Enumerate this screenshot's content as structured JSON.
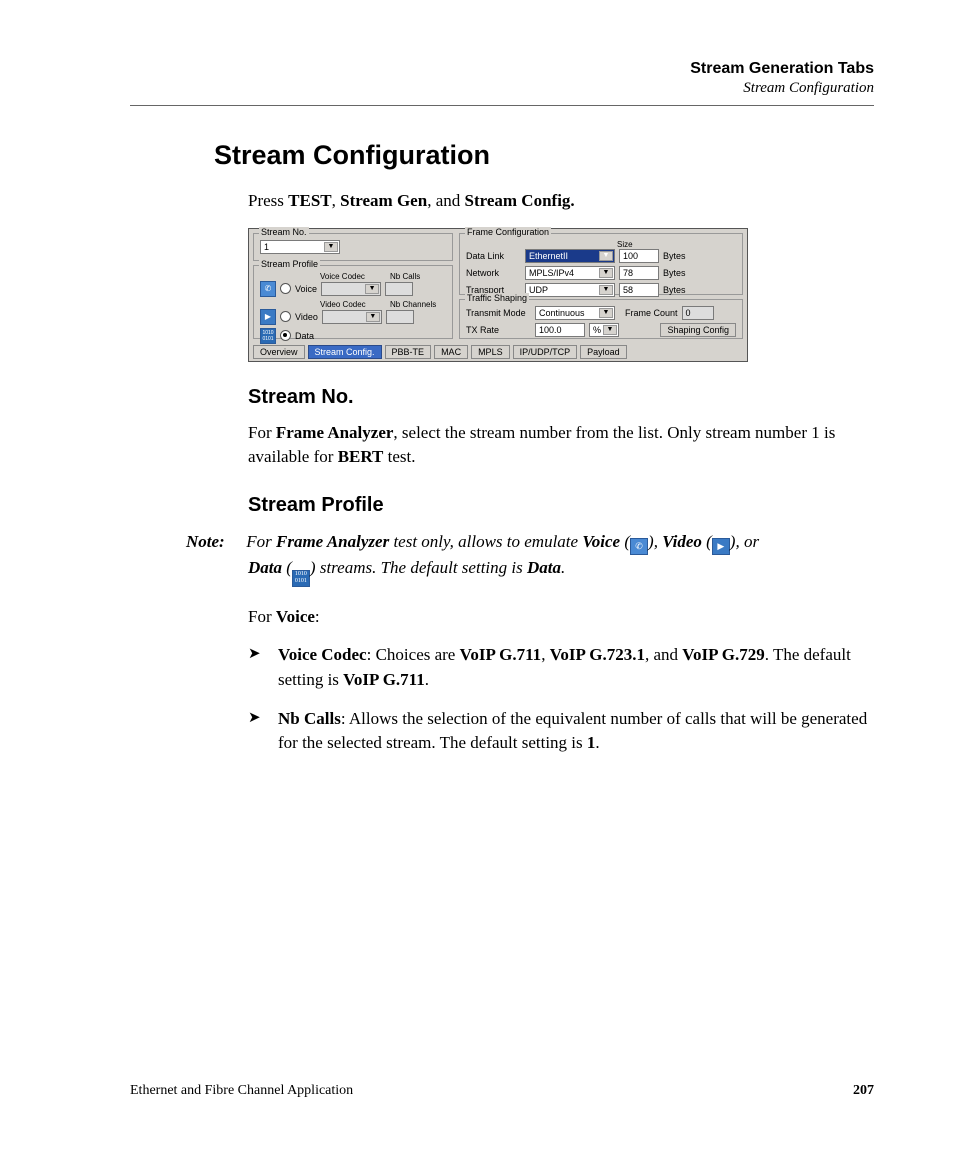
{
  "header": {
    "chapter": "Stream Generation Tabs",
    "section": "Stream Configuration"
  },
  "h1": "Stream Configuration",
  "intro": {
    "prefix": "Press ",
    "b1": "TEST",
    "sep1": ", ",
    "b2": "Stream Gen",
    "sep2": ", and ",
    "b3": "Stream Config.",
    "suffix": ""
  },
  "ui": {
    "stream_no": {
      "label": "Stream No.",
      "value": "1"
    },
    "stream_profile": {
      "label": "Stream Profile",
      "voice_codec_lbl": "Voice Codec",
      "nb_calls_lbl": "Nb Calls",
      "video_codec_lbl": "Video Codec",
      "nb_channels_lbl": "Nb Channels",
      "voice": "Voice",
      "video": "Video",
      "data": "Data"
    },
    "frame_cfg": {
      "label": "Frame Configuration",
      "size_lbl": "Size",
      "datalink_lbl": "Data Link",
      "datalink_val": "EthernetII",
      "datalink_size": "100",
      "network_lbl": "Network",
      "network_val": "MPLS/IPv4",
      "network_size": "78",
      "transport_lbl": "Transport",
      "transport_val": "UDP",
      "transport_size": "58",
      "bytes": "Bytes"
    },
    "shaping": {
      "label": "Traffic Shaping",
      "tx_mode_lbl": "Transmit Mode",
      "tx_mode_val": "Continuous",
      "frame_count_lbl": "Frame Count",
      "frame_count_val": "0",
      "tx_rate_lbl": "TX Rate",
      "tx_rate_val": "100.0",
      "pct": "%",
      "btn": "Shaping Config"
    },
    "tabs": [
      "Overview",
      "Stream Config.",
      "PBB-TE",
      "MAC",
      "MPLS",
      "IP/UDP/TCP",
      "Payload"
    ]
  },
  "h2a": "Stream No.",
  "p_streamno": {
    "t1": "For ",
    "b1": "Frame Analyzer",
    "t2": ", select the stream number from the list. Only stream number 1 is available for ",
    "b2": "BERT",
    "t3": " test."
  },
  "h2b": "Stream Profile",
  "note": {
    "label": "Note:",
    "t1": "For ",
    "b1": "Frame Analyzer",
    "t2": " test only, allows to emulate ",
    "b2": "Voice",
    "t3": " (",
    "t4": "), ",
    "b3": "Video",
    "t5": " (",
    "t6": "), or ",
    "b4": "Data",
    "t7": " (",
    "t8": ") streams. The default setting is ",
    "b5": "Data",
    "t9": "."
  },
  "for_voice": {
    "t1": "For ",
    "b1": "Voice",
    "t2": ":"
  },
  "li1": {
    "b1": "Voice Codec",
    "t1": ": Choices are ",
    "b2": "VoIP G.711",
    "t2": ", ",
    "b3": "VoIP G.723.1",
    "t3": ", and ",
    "b4": "VoIP G.729",
    "t4": ". The default setting is ",
    "b5": "VoIP G.711",
    "t5": "."
  },
  "li2": {
    "b1": "Nb Calls",
    "t1": ": Allows the selection of the equivalent number of calls that will be generated for the selected stream. The default setting is ",
    "b2": "1",
    "t2": "."
  },
  "footer": {
    "left": "Ethernet and Fibre Channel Application",
    "page": "207"
  }
}
